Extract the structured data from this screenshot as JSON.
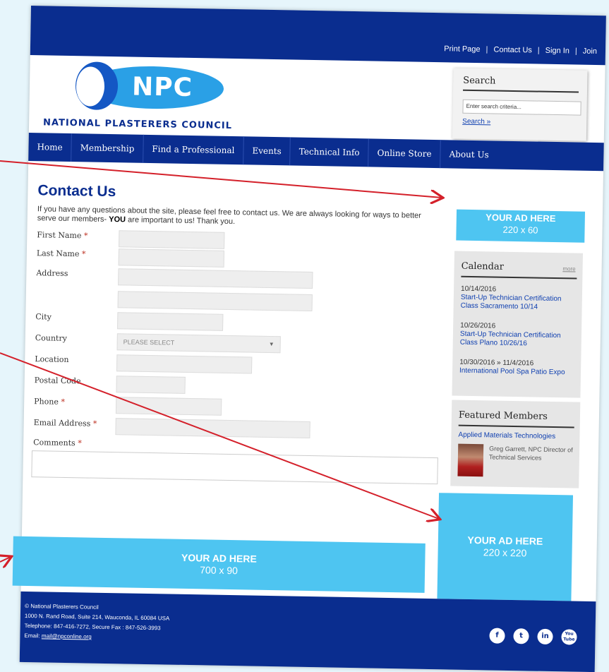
{
  "toplinks": {
    "print": "Print Page",
    "contact": "Contact Us",
    "signin": "Sign In",
    "join": "Join",
    "sep": "|"
  },
  "logo": {
    "abbr": "NPC",
    "name": "NATIONAL PLASTERERS COUNCIL"
  },
  "search": {
    "title": "Search",
    "placeholder": "Enter search criteria...",
    "link": "Search »"
  },
  "nav": {
    "items": [
      "Home",
      "Membership",
      "Find a Professional",
      "Events",
      "Technical Info",
      "Online Store",
      "About Us"
    ]
  },
  "page": {
    "title": "Contact Us",
    "intro_a": "If you have any questions about the site, please feel free to contact us. We are always looking for ways to better serve our members- ",
    "intro_bold": "YOU",
    "intro_b": " are important to us! Thank you."
  },
  "form": {
    "required_marker": "*",
    "first_name": "First Name",
    "last_name": "Last Name",
    "address": "Address",
    "city": "City",
    "country": "Country",
    "country_value": "PLEASE SELECT",
    "location": "Location",
    "postal": "Postal Code",
    "phone": "Phone",
    "email": "Email Address",
    "comments": "Comments"
  },
  "ads": {
    "top": {
      "line1": "YOUR AD HERE",
      "line2": "220 x 60"
    },
    "side": {
      "line1": "YOUR AD HERE",
      "line2": "220 x 220"
    },
    "bottom": {
      "line1": "YOUR AD HERE",
      "line2": "700 x 90"
    }
  },
  "calendar": {
    "title": "Calendar",
    "more": "more",
    "events": [
      {
        "date": "10/14/2016",
        "title": "Start-Up Technician Certification Class Sacramento 10/14"
      },
      {
        "date": "10/26/2016",
        "title": "Start-Up Technician Certification Class Plano 10/26/16"
      },
      {
        "date": "10/30/2016 » 11/4/2016",
        "title": "International Pool Spa Patio Expo"
      }
    ]
  },
  "featured": {
    "title": "Featured Members",
    "company": "Applied Materials Technologies",
    "person": "Greg Garrett, NPC Director of Technical Services"
  },
  "footer": {
    "copyright": "© National Plasterers Council",
    "address": "1000 N. Rand Road, Suite 214, Wauconda, IL 60084 USA",
    "phone": "Telephone: 847-416-7272, Secure Fax : 847-526-3993",
    "email_label": "Email:",
    "email": "mail@npconline.org"
  },
  "social": [
    "f",
    "t",
    "in",
    "You Tube"
  ],
  "colors": {
    "navy": "#0a2d8f",
    "ad": "#4ec5f1",
    "arrow": "#d4202a"
  }
}
